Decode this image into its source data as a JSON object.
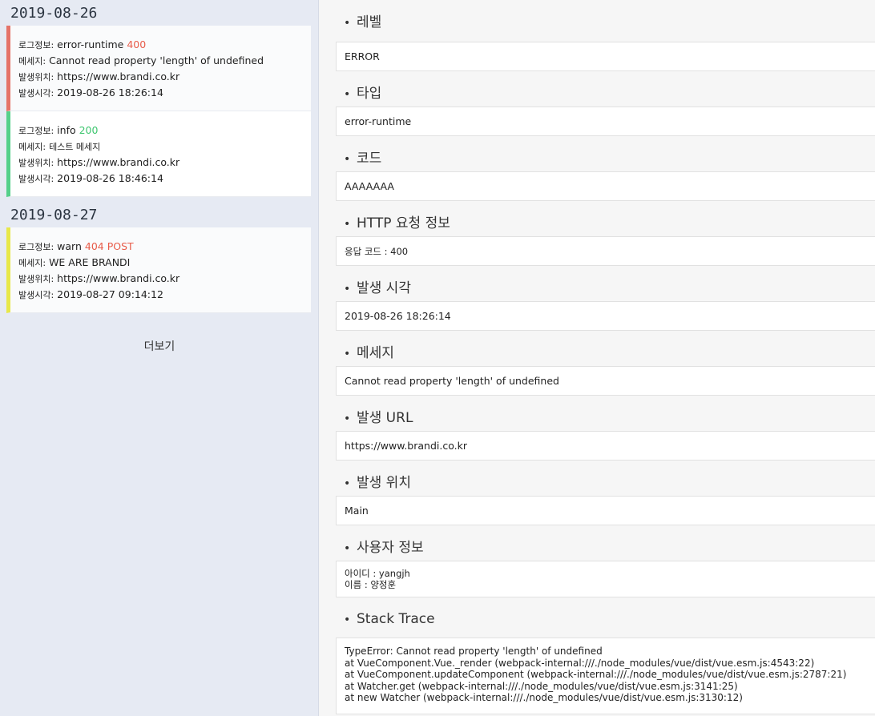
{
  "logs": {
    "groups": [
      {
        "date": "2019-08-26",
        "items": [
          {
            "info_label": "로그정보:",
            "type": "error-runtime",
            "status": "400",
            "msg_label": "메세지:",
            "message": "Cannot read property 'length' of undefined",
            "loc_label": "발생위치:",
            "location": "https://www.brandi.co.kr",
            "time_label": "발생시각:",
            "time": "2019-08-26 18:26:14"
          },
          {
            "info_label": "로그정보:",
            "type": "info",
            "status": "200",
            "msg_label": "메세지:",
            "message": "테스트 메세지",
            "loc_label": "발생위치:",
            "location": "https://www.brandi.co.kr",
            "time_label": "발생시각:",
            "time": "2019-08-26 18:46:14"
          }
        ]
      },
      {
        "date": "2019-08-27",
        "items": [
          {
            "info_label": "로그정보:",
            "type": "warn",
            "status": "404 POST",
            "msg_label": "메세지:",
            "message": "WE ARE BRANDI",
            "loc_label": "발생위치:",
            "location": "https://www.brandi.co.kr",
            "time_label": "발생시각:",
            "time": "2019-08-27 09:14:12"
          }
        ]
      }
    ],
    "more_label": "더보기"
  },
  "detail": {
    "bullet": "•",
    "level": {
      "title": "레벨",
      "value": "ERROR"
    },
    "type": {
      "title": "타입",
      "value": "error-runtime"
    },
    "code": {
      "title": "코드",
      "value": "AAAAAAA"
    },
    "http": {
      "title": "HTTP 요청 정보",
      "value": "응답 코드 : 400"
    },
    "time": {
      "title": "발생 시각",
      "value": "2019-08-26 18:26:14"
    },
    "message": {
      "title": "메세지",
      "value": "Cannot read property 'length' of undefined"
    },
    "url": {
      "title": "발생 URL",
      "value": "https://www.brandi.co.kr"
    },
    "location": {
      "title": "발생 위치",
      "value": "Main"
    },
    "user": {
      "title": "사용자 정보",
      "id_line": "아이디 : yangjh",
      "name_line": "이름 : 양정훈"
    },
    "stack": {
      "title": "Stack Trace",
      "lines": [
        "TypeError: Cannot read property 'length' of undefined",
        "at VueComponent.Vue._render (webpack-internal:///./node_modules/vue/dist/vue.esm.js:4543:22)",
        "at VueComponent.updateComponent (webpack-internal:///./node_modules/vue/dist/vue.esm.js:2787:21)",
        "at Watcher.get (webpack-internal:///./node_modules/vue/dist/vue.esm.js:3141:25)",
        "at new Watcher (webpack-internal:///./node_modules/vue/dist/vue.esm.js:3130:12)"
      ]
    }
  }
}
